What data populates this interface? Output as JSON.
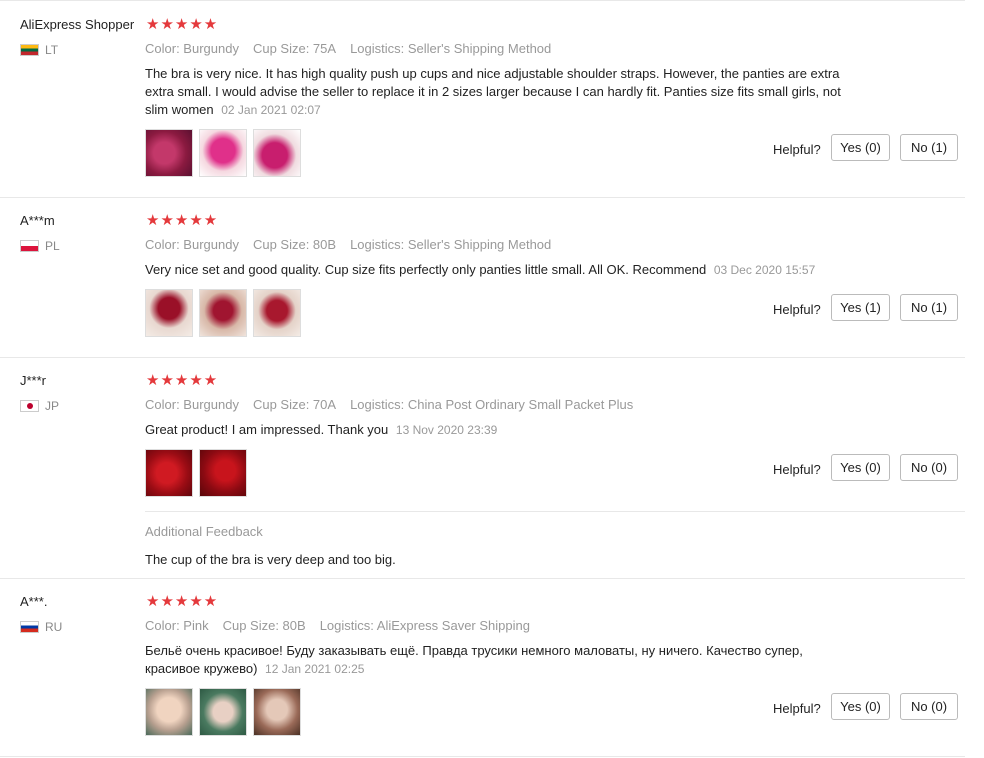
{
  "reviews": [
    {
      "user": "AliExpress Shopper",
      "country": "LT",
      "stars": "★★★★★",
      "color": "Color: Burgundy",
      "cup": "Cup Size: 75A",
      "logistics": "Logistics: Seller's Shipping Method",
      "text": "The bra is very nice. It has high quality push up cups and nice adjustable shoulder straps. However, the panties are extra extra small. I would advise the seller to replace it in 2 sizes larger because I can hardly fit. Panties size fits small girls, not slim women",
      "date": "02 Jan 2021 02:07",
      "helpful": "Helpful?",
      "yes": "Yes (0)",
      "no": "No (1)"
    },
    {
      "user": "A***m",
      "country": "PL",
      "stars": "★★★★★",
      "color": "Color: Burgundy",
      "cup": "Cup Size: 80B",
      "logistics": "Logistics: Seller's Shipping Method",
      "text": "Very nice set and good quality. Cup size fits perfectly only panties little small. All OK. Recommend",
      "date": "03 Dec 2020 15:57",
      "helpful": "Helpful?",
      "yes": "Yes (1)",
      "no": "No (1)"
    },
    {
      "user": "J***r",
      "country": "JP",
      "stars": "★★★★★",
      "color": "Color: Burgundy",
      "cup": "Cup Size: 70A",
      "logistics": "Logistics: China Post Ordinary Small Packet Plus",
      "text": "Great product! I am impressed. Thank you",
      "date": "13 Nov 2020 23:39",
      "helpful": "Helpful?",
      "yes": "Yes (0)",
      "no": "No (0)",
      "additional_label": "Additional Feedback",
      "additional_text": "The cup of the bra is very deep and too big."
    },
    {
      "user": "A***.",
      "country": "RU",
      "stars": "★★★★★",
      "color": "Color: Pink",
      "cup": "Cup Size: 80B",
      "logistics": "Logistics: AliExpress Saver Shipping",
      "text": "Бельё очень красивое! Буду заказывать ещё. Правда трусики немного маловаты, ну ничего. Качество супер, красивое кружево)",
      "date": "12 Jan 2021 02:25",
      "helpful": "Helpful?",
      "yes": "Yes (0)",
      "no": "No (0)"
    }
  ],
  "colors": {
    "star": "#e4393c",
    "burgundy": "#8b1030",
    "pink": "#e8c9b8"
  }
}
